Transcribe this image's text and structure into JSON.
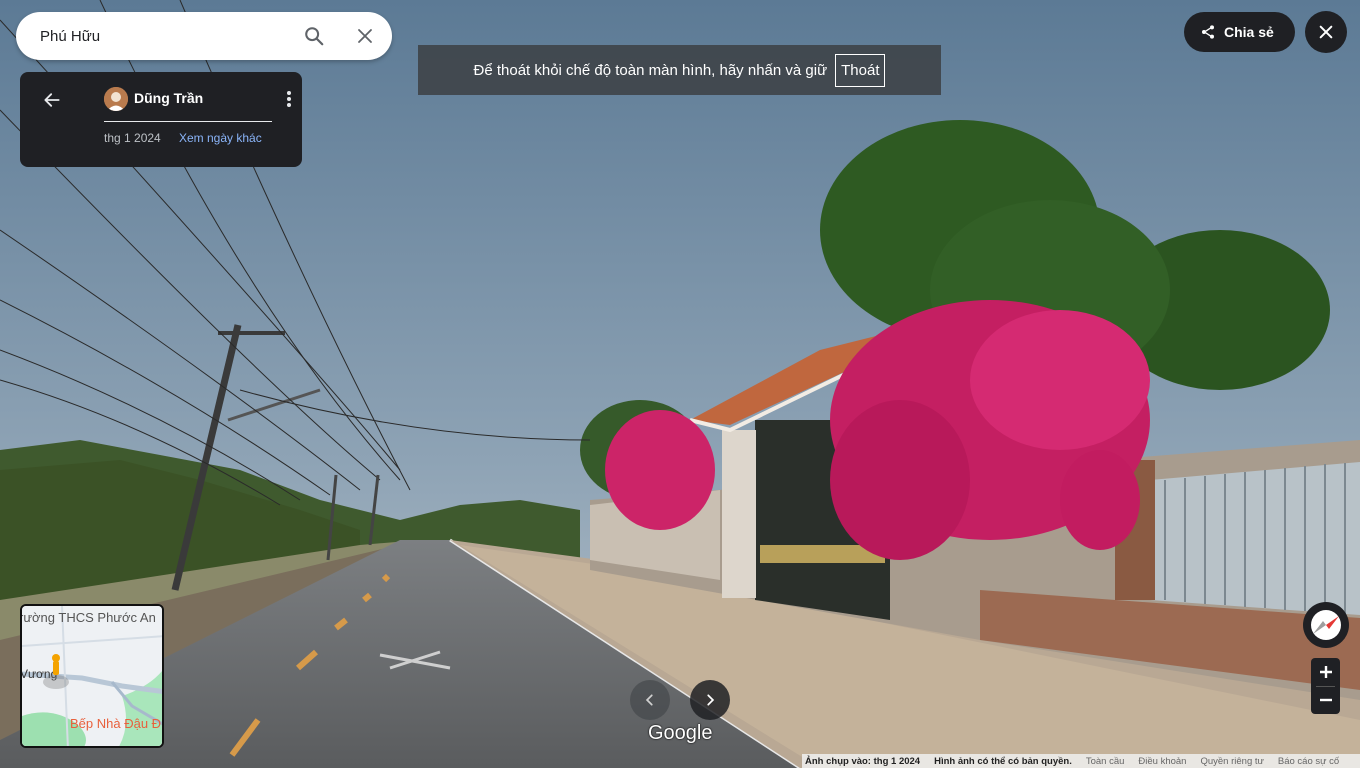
{
  "search": {
    "value": "Phú Hữu"
  },
  "panel": {
    "author": "Dũng Trần",
    "capture_date": "thg 1 2024",
    "other_dates": "Xem ngày khác"
  },
  "banner": {
    "text": "Để thoát khỏi chế độ toàn màn hình, hãy nhấn và giữ",
    "exit_label": "Thoát"
  },
  "share": {
    "label": "Chia sẻ"
  },
  "minimap": {
    "labels": [
      "rường THCS Phước An",
      "Vương",
      "Bếp Nhà Đậu Đ"
    ]
  },
  "brand": "Google",
  "footer": {
    "capture": "Ảnh chụp vào: thg 1 2024",
    "copyright": "Hình ảnh có thể có bản quyền.",
    "global": "Toàn cầu",
    "terms": "Điều khoản",
    "privacy": "Quyền riêng tư",
    "report": "Báo cáo sự cố"
  },
  "colors": {
    "panel": "#1f2024",
    "link": "#8ab4f8",
    "flowers": "#d6246e"
  }
}
